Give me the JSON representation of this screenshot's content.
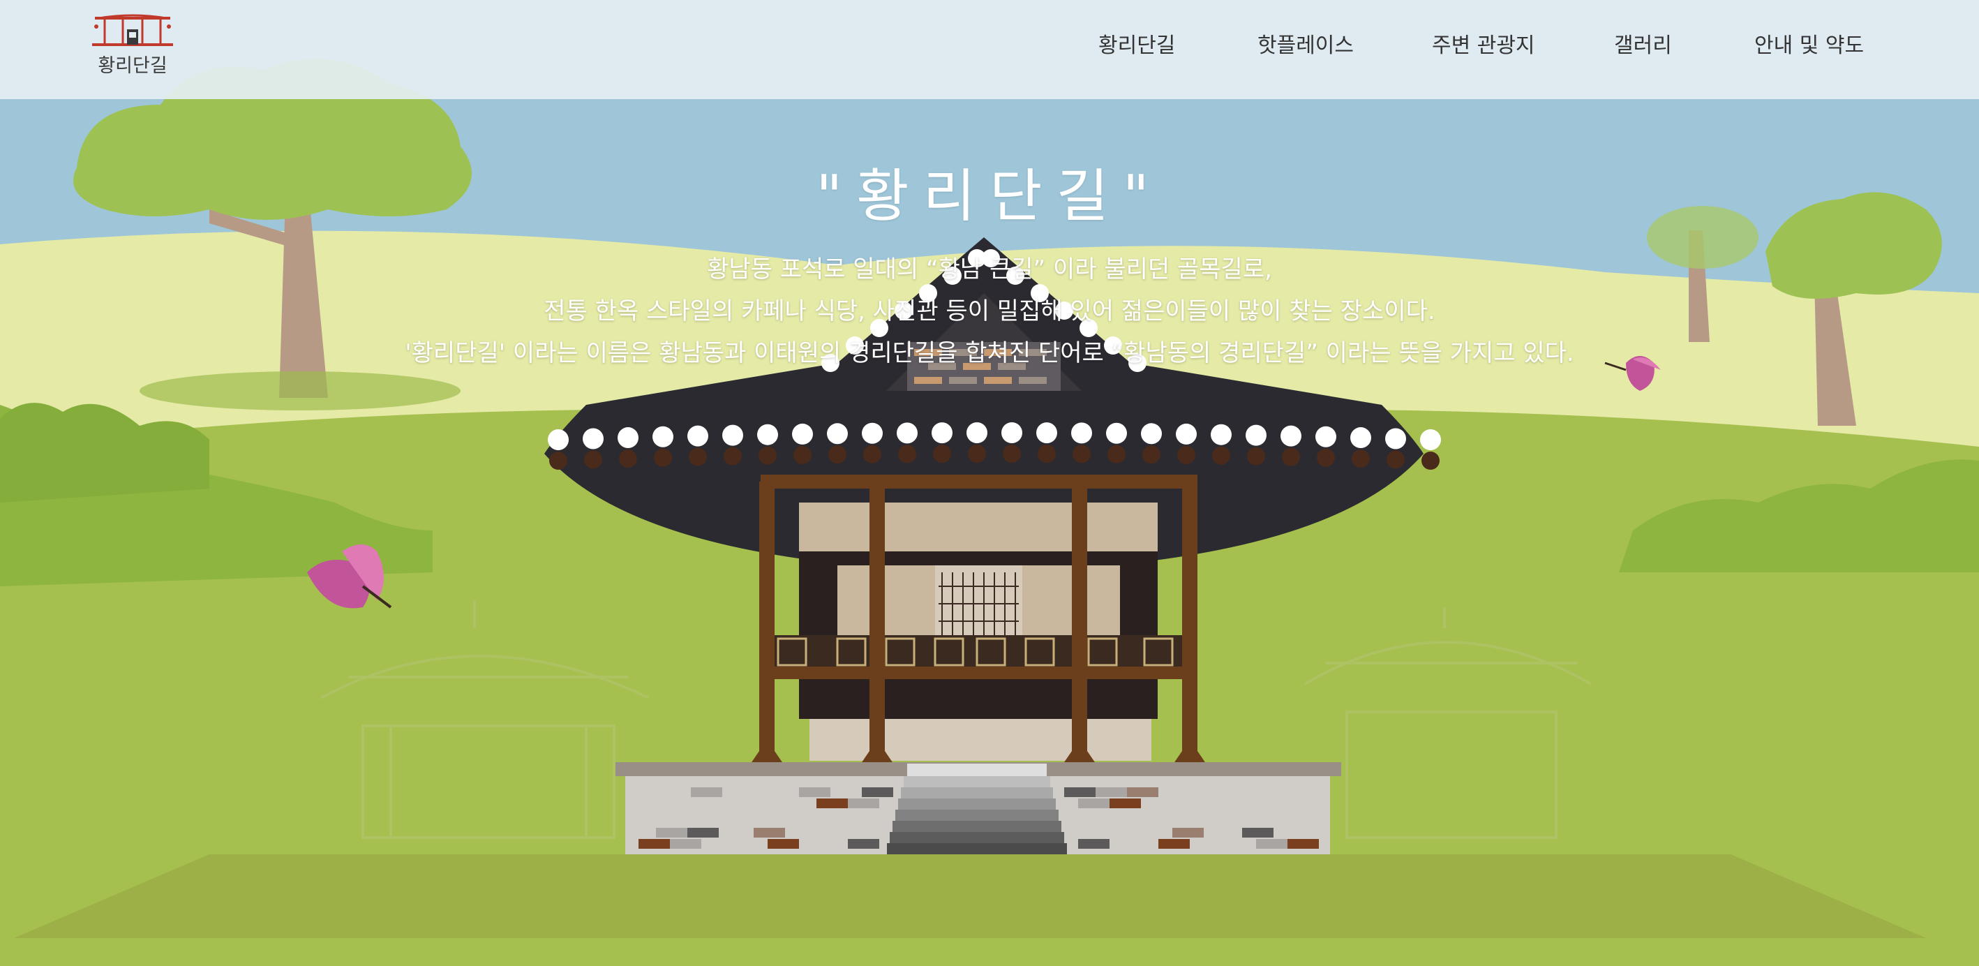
{
  "logo": {
    "text": "황리단길",
    "icon": "hanok-gate-logo-icon",
    "color": "#c0392b"
  },
  "nav": {
    "items": [
      {
        "label": "황리단길"
      },
      {
        "label": "핫플레이스"
      },
      {
        "label": "주변 관광지"
      },
      {
        "label": "갤러리"
      },
      {
        "label": "안내 및 약도"
      }
    ]
  },
  "hero": {
    "title": "\"황리단길\"",
    "lines": [
      "황남동 포석로 일대의 “황남 큰길” 이라 불리던 골목길로,",
      "전통 한옥 스타일의 카페나 식당, 사진관 등이 밀집해 있어 젊은이들이 많이 찾는 장소이다.",
      "'황리단길' 이라는 이름은 황남동과 이태원의 경리단길을 합쳐진 단어로 “황남동의 경리단길” 이라는 뜻을 가지고 있다."
    ]
  },
  "colors": {
    "sky": "#9ec6d8",
    "grass": "#a5c04e",
    "roof": "#2b2a30",
    "wood": "#6b3f1c",
    "butterfly": "#c2549a"
  }
}
